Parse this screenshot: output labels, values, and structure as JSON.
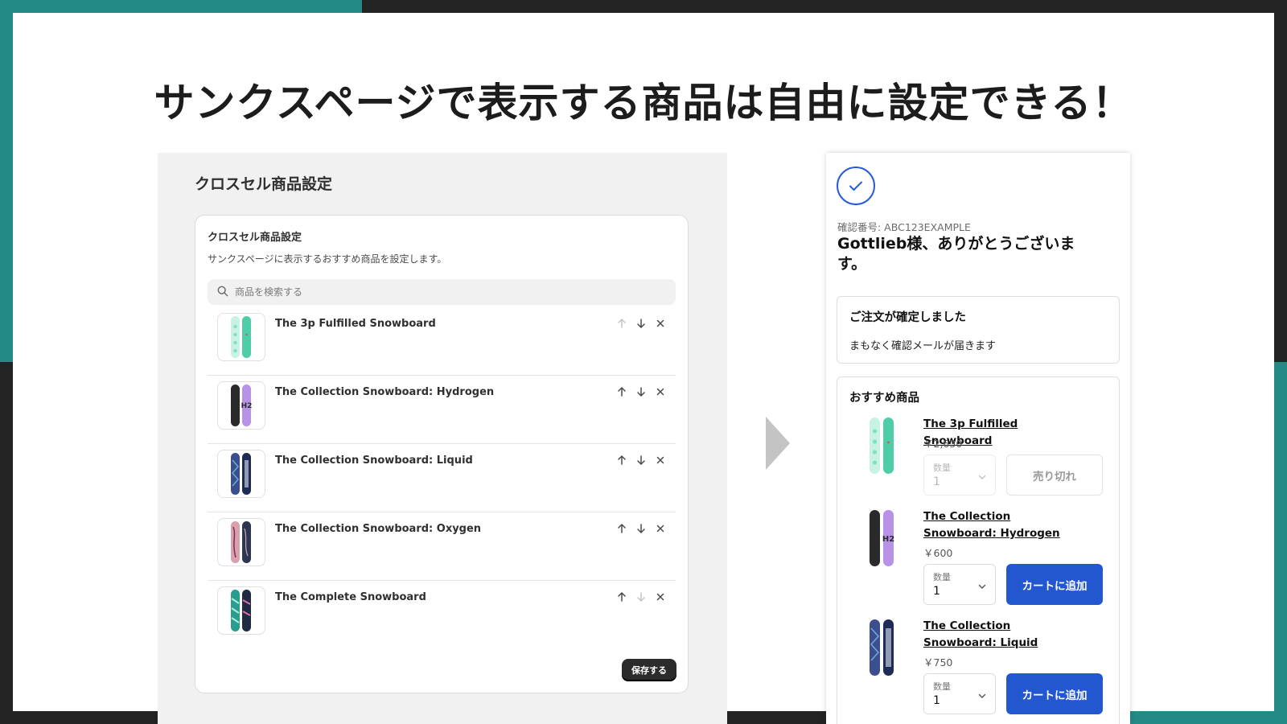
{
  "headline": "サンクスページで表示する商品は自由に設定できる！",
  "admin": {
    "page_title": "クロスセル商品設定",
    "card_title": "クロスセル商品設定",
    "card_description": "サンクスページに表示するおすすめ商品を設定します。",
    "search_placeholder": "商品を検索する",
    "products": [
      {
        "name": "The 3p Fulfilled Snowboard",
        "up_enabled": false,
        "down_enabled": true
      },
      {
        "name": "The Collection Snowboard: Hydrogen",
        "up_enabled": true,
        "down_enabled": true
      },
      {
        "name": "The Collection Snowboard: Liquid",
        "up_enabled": true,
        "down_enabled": true
      },
      {
        "name": "The Collection Snowboard: Oxygen",
        "up_enabled": true,
        "down_enabled": true
      },
      {
        "name": "The Complete Snowboard",
        "up_enabled": true,
        "down_enabled": false
      }
    ],
    "save_label": "保存する"
  },
  "thanks": {
    "confirmation_number": "確認番号: ABC123EXAMPLE",
    "greeting": "Gottlieb様、ありがとうございます。",
    "order_confirmed_title": "ご注文が確定しました",
    "order_confirmed_sub": "まもなく確認メールが届きます",
    "recommended_title": "おすすめ商品",
    "recommended": [
      {
        "name": "The 3p Fulfilled Snowboard",
        "price": "￥2,630",
        "qty_label": "数量",
        "qty": "1",
        "button": "売り切れ",
        "sold_out": true
      },
      {
        "name": "The Collection Snowboard: Hydrogen",
        "price": "￥600",
        "qty_label": "数量",
        "qty": "1",
        "button": "カートに追加",
        "sold_out": false
      },
      {
        "name": "The Collection Snowboard: Liquid",
        "price": "￥750",
        "qty_label": "数量",
        "qty": "1",
        "button": "カートに追加",
        "sold_out": false
      }
    ]
  },
  "icons": {
    "search": "search-icon",
    "arrow_up": "arrow-up-icon",
    "arrow_down": "arrow-down-icon",
    "remove": "close-icon",
    "check": "check-circle-icon",
    "chevron": "chevron-down-icon"
  },
  "colors": {
    "accent_teal": "#248a86",
    "primary_blue": "#2257d0",
    "dark": "#232323"
  }
}
